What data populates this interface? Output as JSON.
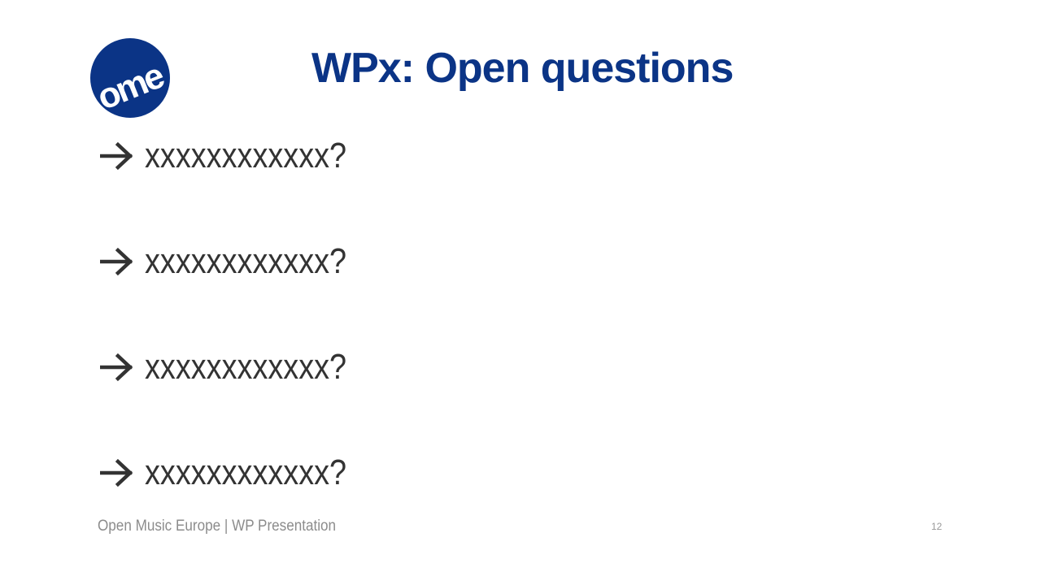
{
  "slide": {
    "title": "WPx: Open questions",
    "logo": {
      "text": "ome",
      "color": "#0b3486"
    },
    "bullets": [
      {
        "icon": "arrow-right-icon",
        "text": "xxxxxxxxxxxx?"
      },
      {
        "icon": "arrow-right-icon",
        "text": "xxxxxxxxxxxx?"
      },
      {
        "icon": "arrow-right-icon",
        "text": "xxxxxxxxxxxx?"
      },
      {
        "icon": "arrow-right-icon",
        "text": "xxxxxxxxxxxx?"
      }
    ],
    "footer": {
      "text": "Open Music Europe | WP Presentation",
      "page_number": "12"
    },
    "colors": {
      "title": "#0b3486",
      "body_text": "#333333",
      "footer_text": "#8c8c8c"
    }
  }
}
